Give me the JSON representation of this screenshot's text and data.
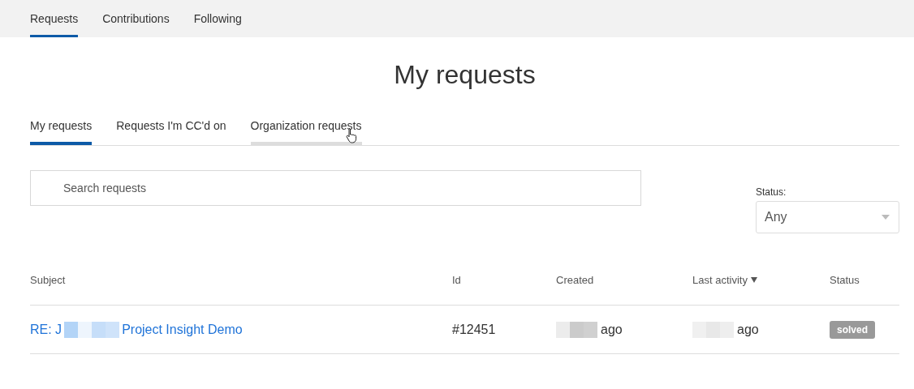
{
  "top_nav": [
    {
      "label": "Requests",
      "selected": true
    },
    {
      "label": "Contributions",
      "selected": false
    },
    {
      "label": "Following",
      "selected": false
    }
  ],
  "page_title": "My requests",
  "tabs": [
    {
      "label": "My requests",
      "selected": true,
      "hovered": false
    },
    {
      "label": "Requests I'm CC'd on",
      "selected": false,
      "hovered": false
    },
    {
      "label": "Organization requests",
      "selected": false,
      "hovered": true
    }
  ],
  "search": {
    "placeholder": "Search requests"
  },
  "status_filter": {
    "label": "Status:",
    "value": "Any"
  },
  "table": {
    "columns": [
      {
        "label": "Subject",
        "sorted": false
      },
      {
        "label": "Id",
        "sorted": false
      },
      {
        "label": "Created",
        "sorted": false
      },
      {
        "label": "Last activity",
        "sorted": true
      },
      {
        "label": "Status",
        "sorted": false
      }
    ],
    "rows": [
      {
        "subject_start": "RE: J",
        "subject_end": "Project Insight Demo",
        "id": "#12451",
        "created": "ago",
        "last_activity": "ago",
        "status": "solved"
      }
    ]
  }
}
